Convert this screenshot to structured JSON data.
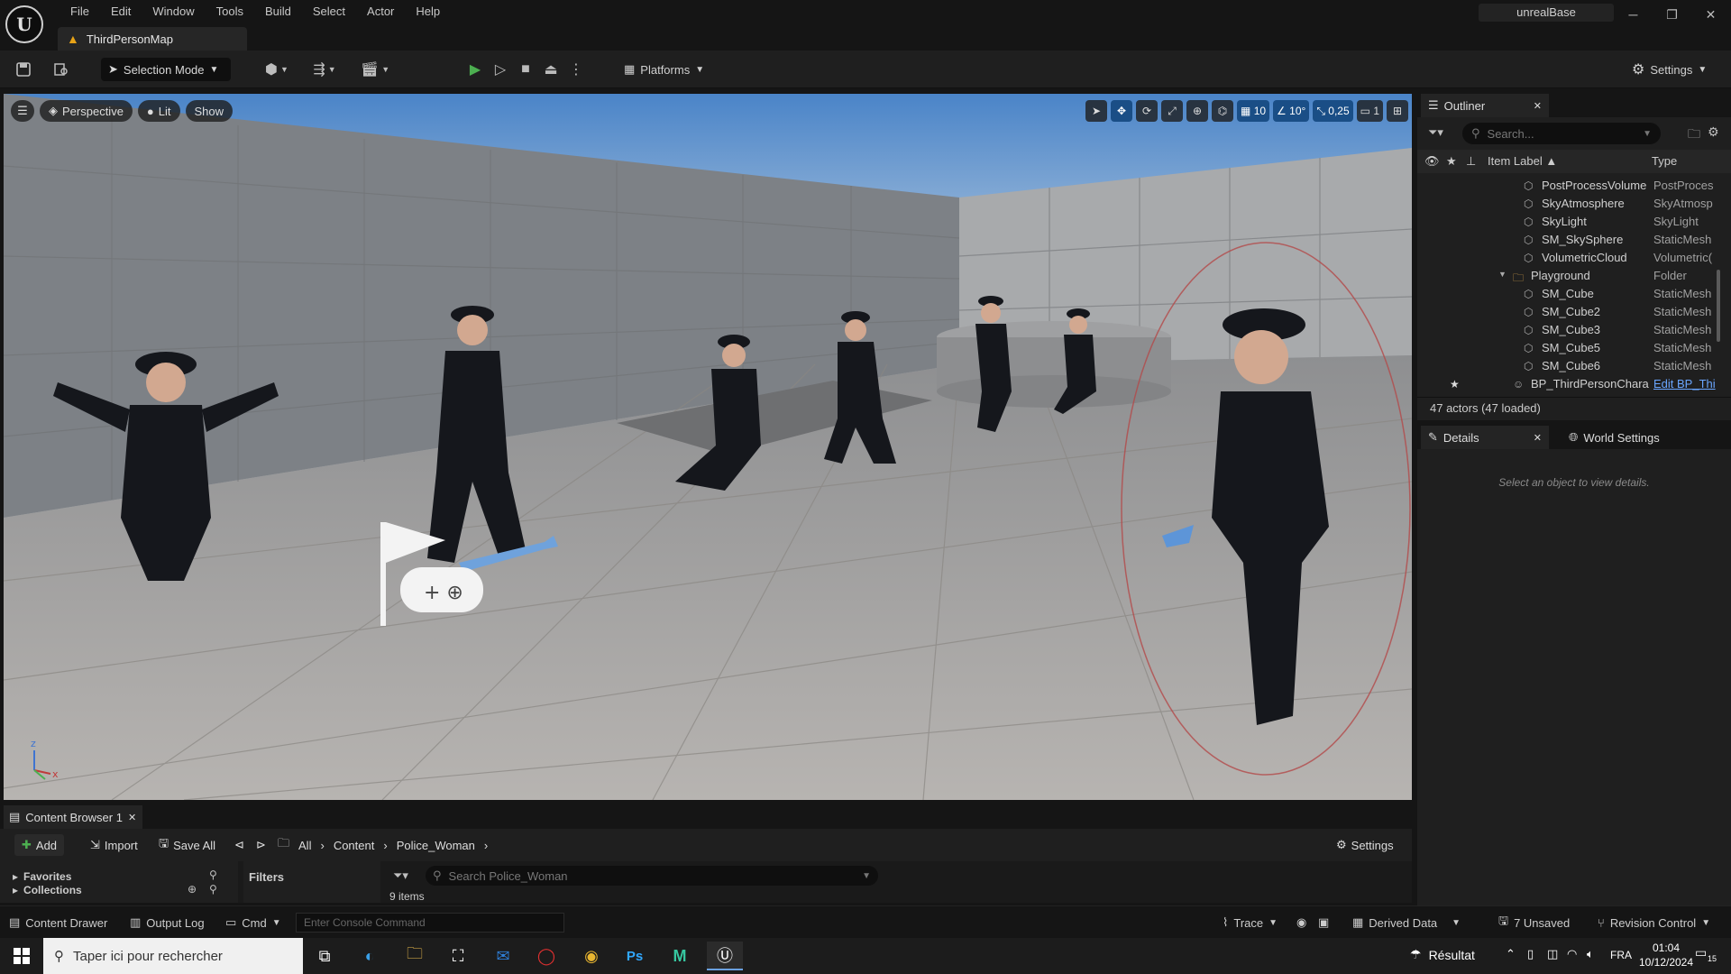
{
  "app": {
    "logo_glyph": "U",
    "menu": [
      "File",
      "Edit",
      "Window",
      "Tools",
      "Build",
      "Select",
      "Actor",
      "Help"
    ],
    "project_name": "unrealBase",
    "level_tab": "ThirdPersonMap"
  },
  "toolbar": {
    "selection_mode": "Selection Mode",
    "platforms": "Platforms",
    "settings": "Settings"
  },
  "viewport": {
    "perspective": "Perspective",
    "lit": "Lit",
    "show": "Show",
    "grid_snap": "10",
    "rotation_snap": "10°",
    "scale_snap": "0,25",
    "camera_speed": "1"
  },
  "outliner": {
    "title": "Outliner",
    "search_placeholder": "Search...",
    "col_label": "Item Label ▲",
    "col_type": "Type",
    "rows": [
      {
        "label": "PostProcessVolume",
        "type": "PostProces",
        "indent": 1
      },
      {
        "label": "SkyAtmosphere",
        "type": "SkyAtmosp",
        "indent": 1
      },
      {
        "label": "SkyLight",
        "type": "SkyLight",
        "indent": 1
      },
      {
        "label": "SM_SkySphere",
        "type": "StaticMesh",
        "indent": 1
      },
      {
        "label": "VolumetricCloud",
        "type": "Volumetric(",
        "indent": 1
      },
      {
        "label": "Playground",
        "type": "Folder",
        "indent": 0
      },
      {
        "label": "SM_Cube",
        "type": "StaticMesh",
        "indent": 1
      },
      {
        "label": "SM_Cube2",
        "type": "StaticMesh",
        "indent": 1
      },
      {
        "label": "SM_Cube3",
        "type": "StaticMesh",
        "indent": 1
      },
      {
        "label": "SM_Cube5",
        "type": "StaticMesh",
        "indent": 1
      },
      {
        "label": "SM_Cube6",
        "type": "StaticMesh",
        "indent": 1
      },
      {
        "label": "BP_ThirdPersonChara",
        "type": "Edit BP_Thi",
        "indent": 0
      }
    ],
    "count": "47 actors (47 loaded)"
  },
  "details": {
    "tab": "Details",
    "world_settings": "World Settings",
    "empty": "Select an object to view details."
  },
  "content_browser": {
    "tab": "Content Browser 1",
    "add": "Add",
    "import": "Import",
    "save_all": "Save All",
    "crumbs": [
      "All",
      "Content",
      "Police_Woman"
    ],
    "settings": "Settings",
    "favorites": "Favorites",
    "collections": "Collections",
    "filters": "Filters",
    "search_placeholder": "Search Police_Woman",
    "items": "9 items"
  },
  "statusbar": {
    "content_drawer": "Content Drawer",
    "output_log": "Output Log",
    "cmd": "Cmd",
    "console_placeholder": "Enter Console Command",
    "trace": "Trace",
    "derived_data": "Derived Data",
    "unsaved": "7 Unsaved",
    "revision_control": "Revision Control"
  },
  "taskbar": {
    "search_placeholder": "Taper ici pour rechercher",
    "weather": "Résultat",
    "lang": "FRA",
    "time": "01:04",
    "date": "10/12/2024",
    "notifications": "15"
  },
  "colors": {
    "accent": "#1a4e86",
    "play_green": "#4caf50",
    "warning": "#e8a317"
  }
}
